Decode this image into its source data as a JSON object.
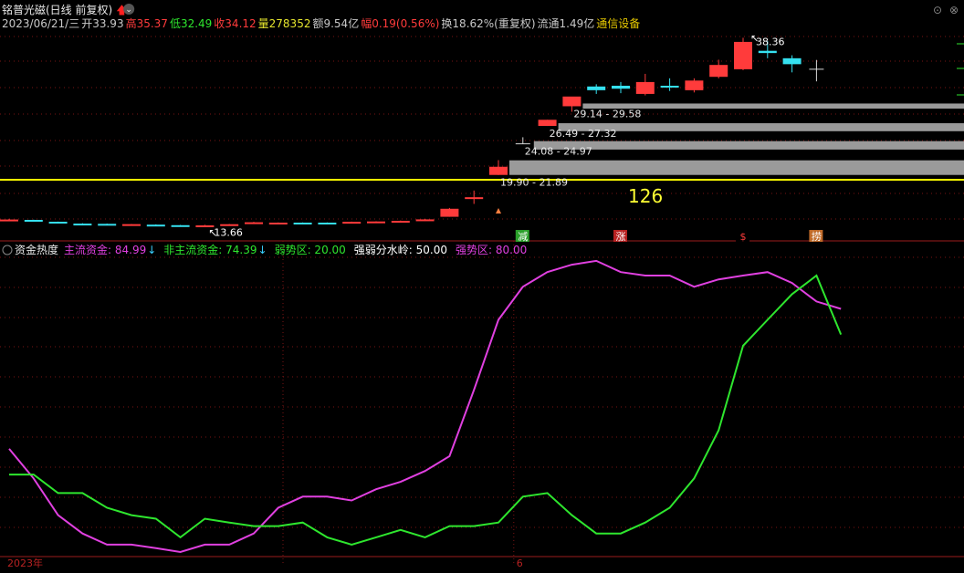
{
  "header": {
    "title": "铭普光磁(日线 前复权)",
    "info": [
      {
        "label": "2023/06/21/三",
        "color": "#c8c8c8"
      },
      {
        "label": "开33.93",
        "color": "#c8c8c8"
      },
      {
        "label": "高35.37",
        "color": "#ff3b3b"
      },
      {
        "label": "低32.49",
        "color": "#2ee62e"
      },
      {
        "label": "收34.12",
        "color": "#ff3b3b"
      },
      {
        "label": "量278352",
        "color": "#e6e62e"
      },
      {
        "label": "额9.54亿",
        "color": "#c8c8c8"
      },
      {
        "label": "幅0.19(0.56%)",
        "color": "#ff3b3b"
      },
      {
        "label": "换18.62%(重复权)",
        "color": "#c8c8c8"
      },
      {
        "label": "流通1.49亿",
        "color": "#c8c8c8"
      },
      {
        "label": "通信设备",
        "color": "#e6c800"
      }
    ]
  },
  "indicator_header": {
    "name": "资金热度",
    "items": [
      {
        "label": "主流资金: 84.99",
        "color": "#e040e0",
        "arrow": "↓",
        "arrow_color": "#3ad0ff"
      },
      {
        "label": "非主流资金: 74.39",
        "color": "#2ee62e",
        "arrow": "↓",
        "arrow_color": "#3ad0ff"
      },
      {
        "label": "弱势区: 20.00",
        "color": "#2ee62e",
        "arrow": "",
        "arrow_color": ""
      },
      {
        "label": "强弱分水岭: 50.00",
        "color": "#ffffff",
        "arrow": "",
        "arrow_color": ""
      },
      {
        "label": "强势区: 80.00",
        "color": "#e040e0",
        "arrow": "",
        "arrow_color": ""
      }
    ]
  },
  "chart_data": [
    {
      "type": "candlestick",
      "colors": {
        "up": "#ff3b3b",
        "down": "#35e0ef",
        "doji": "#d8d8d8"
      },
      "candles": [
        {
          "o": 13.9,
          "h": 14.0,
          "l": 13.8,
          "c": 13.83,
          "dir": "up"
        },
        {
          "o": 13.85,
          "h": 13.88,
          "l": 13.64,
          "c": 13.69,
          "dir": "down"
        },
        {
          "o": 13.6,
          "h": 13.62,
          "l": 13.4,
          "c": 13.43,
          "dir": "down"
        },
        {
          "o": 13.33,
          "h": 13.4,
          "l": 13.3,
          "c": 13.35,
          "dir": "down"
        },
        {
          "o": 13.32,
          "h": 13.35,
          "l": 13.25,
          "c": 13.27,
          "dir": "down"
        },
        {
          "o": 13.25,
          "h": 13.3,
          "l": 13.2,
          "c": 13.28,
          "dir": "up"
        },
        {
          "o": 13.21,
          "h": 13.25,
          "l": 13.13,
          "c": 13.16,
          "dir": "down"
        },
        {
          "o": 13.14,
          "h": 13.17,
          "l": 13.08,
          "c": 13.12,
          "dir": "down"
        },
        {
          "o": 13.0,
          "h": 13.19,
          "l": 12.92,
          "c": 13.11,
          "dir": "up"
        },
        {
          "o": 13.1,
          "h": 13.3,
          "l": 13.05,
          "c": 13.27,
          "dir": "up"
        },
        {
          "o": 13.35,
          "h": 13.59,
          "l": 13.3,
          "c": 13.53,
          "dir": "up"
        },
        {
          "o": 13.46,
          "h": 13.51,
          "l": 13.4,
          "c": 13.48,
          "dir": "up"
        },
        {
          "o": 13.46,
          "h": 13.51,
          "l": 13.4,
          "c": 13.48,
          "dir": "down"
        },
        {
          "o": 13.48,
          "h": 13.51,
          "l": 13.43,
          "c": 13.45,
          "dir": "down"
        },
        {
          "o": 13.45,
          "h": 13.62,
          "l": 13.43,
          "c": 13.59,
          "dir": "up"
        },
        {
          "o": 13.5,
          "h": 13.67,
          "l": 13.48,
          "c": 13.64,
          "dir": "up"
        },
        {
          "o": 13.6,
          "h": 13.76,
          "l": 13.58,
          "c": 13.72,
          "dir": "up"
        },
        {
          "o": 13.75,
          "h": 13.99,
          "l": 13.7,
          "c": 13.92,
          "dir": "up"
        },
        {
          "o": 14.27,
          "h": 15.46,
          "l": 14.27,
          "c": 15.35,
          "dir": "up"
        },
        {
          "o": 16.8,
          "h": 17.8,
          "l": 16.0,
          "c": 16.9,
          "dir": "up"
        },
        {
          "o": 19.9,
          "h": 21.89,
          "l": 19.9,
          "c": 21.0,
          "dir": "up"
        },
        {
          "o": 24.08,
          "h": 24.97,
          "l": 24.08,
          "c": 24.08,
          "dir": "doji"
        },
        {
          "o": 26.49,
          "h": 27.32,
          "l": 26.49,
          "c": 27.32,
          "dir": "up"
        },
        {
          "o": 29.14,
          "h": 29.58,
          "l": 28.4,
          "c": 30.45,
          "dir": "up"
        },
        {
          "o": 31.8,
          "h": 32.1,
          "l": 30.8,
          "c": 31.3,
          "dir": "down"
        },
        {
          "o": 31.9,
          "h": 32.4,
          "l": 30.9,
          "c": 31.5,
          "dir": "down"
        },
        {
          "o": 30.8,
          "h": 33.5,
          "l": 30.6,
          "c": 32.4,
          "dir": "up"
        },
        {
          "o": 31.8,
          "h": 32.9,
          "l": 31.2,
          "c": 31.9,
          "dir": "down"
        },
        {
          "o": 31.3,
          "h": 32.9,
          "l": 31.0,
          "c": 32.6,
          "dir": "up"
        },
        {
          "o": 33.1,
          "h": 35.4,
          "l": 32.9,
          "c": 34.7,
          "dir": "up"
        },
        {
          "o": 34.12,
          "h": 38.36,
          "l": 34.0,
          "c": 37.8,
          "dir": "up"
        },
        {
          "o": 36.6,
          "h": 37.9,
          "l": 35.6,
          "c": 36.3,
          "dir": "down"
        },
        {
          "o": 35.6,
          "h": 36.0,
          "l": 33.7,
          "c": 34.8,
          "dir": "down"
        },
        {
          "o": 33.93,
          "h": 35.37,
          "l": 32.49,
          "c": 34.12,
          "dir": "doji"
        }
      ],
      "annotations": [
        {
          "text": "13.66",
          "color": "#ffffff"
        },
        {
          "text": "38.36",
          "color": "#ffffff"
        },
        {
          "text": "126",
          "color": "#ffff33"
        }
      ],
      "price_bands": [
        {
          "label": "19.90 - 21.89",
          "low": 19.9,
          "high": 21.89
        },
        {
          "label": "24.08 - 24.97",
          "low": 24.08,
          "high": 24.97
        },
        {
          "label": "26.49 - 27.32",
          "low": 26.49,
          "high": 27.32
        },
        {
          "label": "29.14 - 29.58",
          "low": 29.14,
          "high": 29.58
        }
      ],
      "yellow_line_value": 19.9,
      "markers": [
        {
          "text": "减",
          "bg": "#2aa02a",
          "fg": "#ffffff",
          "candle": 21
        },
        {
          "text": "涨",
          "bg": "#b82222",
          "fg": "#ffffff",
          "candle": 25
        },
        {
          "text": "$",
          "bg": "#000000",
          "fg": "#ff3b3b",
          "candle": 30
        },
        {
          "text": "捞",
          "bg": "#c06a28",
          "fg": "#ffffff",
          "candle": 33
        }
      ],
      "ylim": [
        12.5,
        40
      ]
    },
    {
      "type": "line",
      "title": "资金热度",
      "ylim": [
        0,
        100
      ],
      "series": [
        {
          "name": "主流资金",
          "color": "#e040e0",
          "values": [
            35.0,
            25.0,
            12.5,
            6.3,
            2.5,
            2.5,
            1.3,
            0.0,
            2.5,
            2.5,
            6.3,
            15.0,
            18.8,
            18.8,
            17.5,
            21.3,
            23.8,
            27.5,
            32.5,
            55.0,
            78.8,
            90.0,
            95.0,
            97.5,
            98.8,
            95.0,
            93.8,
            93.8,
            90.0,
            92.5,
            93.8,
            95.0,
            91.3,
            85.0,
            82.5
          ]
        },
        {
          "name": "非主流资金",
          "color": "#2ee62e",
          "values": [
            26.3,
            26.3,
            20.0,
            20.0,
            15.0,
            12.5,
            11.3,
            5.0,
            11.3,
            10.0,
            8.8,
            8.8,
            10.0,
            5.0,
            2.5,
            5.0,
            7.5,
            5.0,
            8.8,
            8.8,
            10.0,
            18.8,
            20.0,
            12.5,
            6.3,
            6.3,
            10.0,
            15.0,
            25.0,
            41.3,
            70.0,
            78.8,
            87.5,
            93.8,
            73.8
          ]
        }
      ]
    }
  ],
  "bottom_axis": {
    "start_label": "2023年",
    "month_label": "6",
    "month_candle": 21
  }
}
